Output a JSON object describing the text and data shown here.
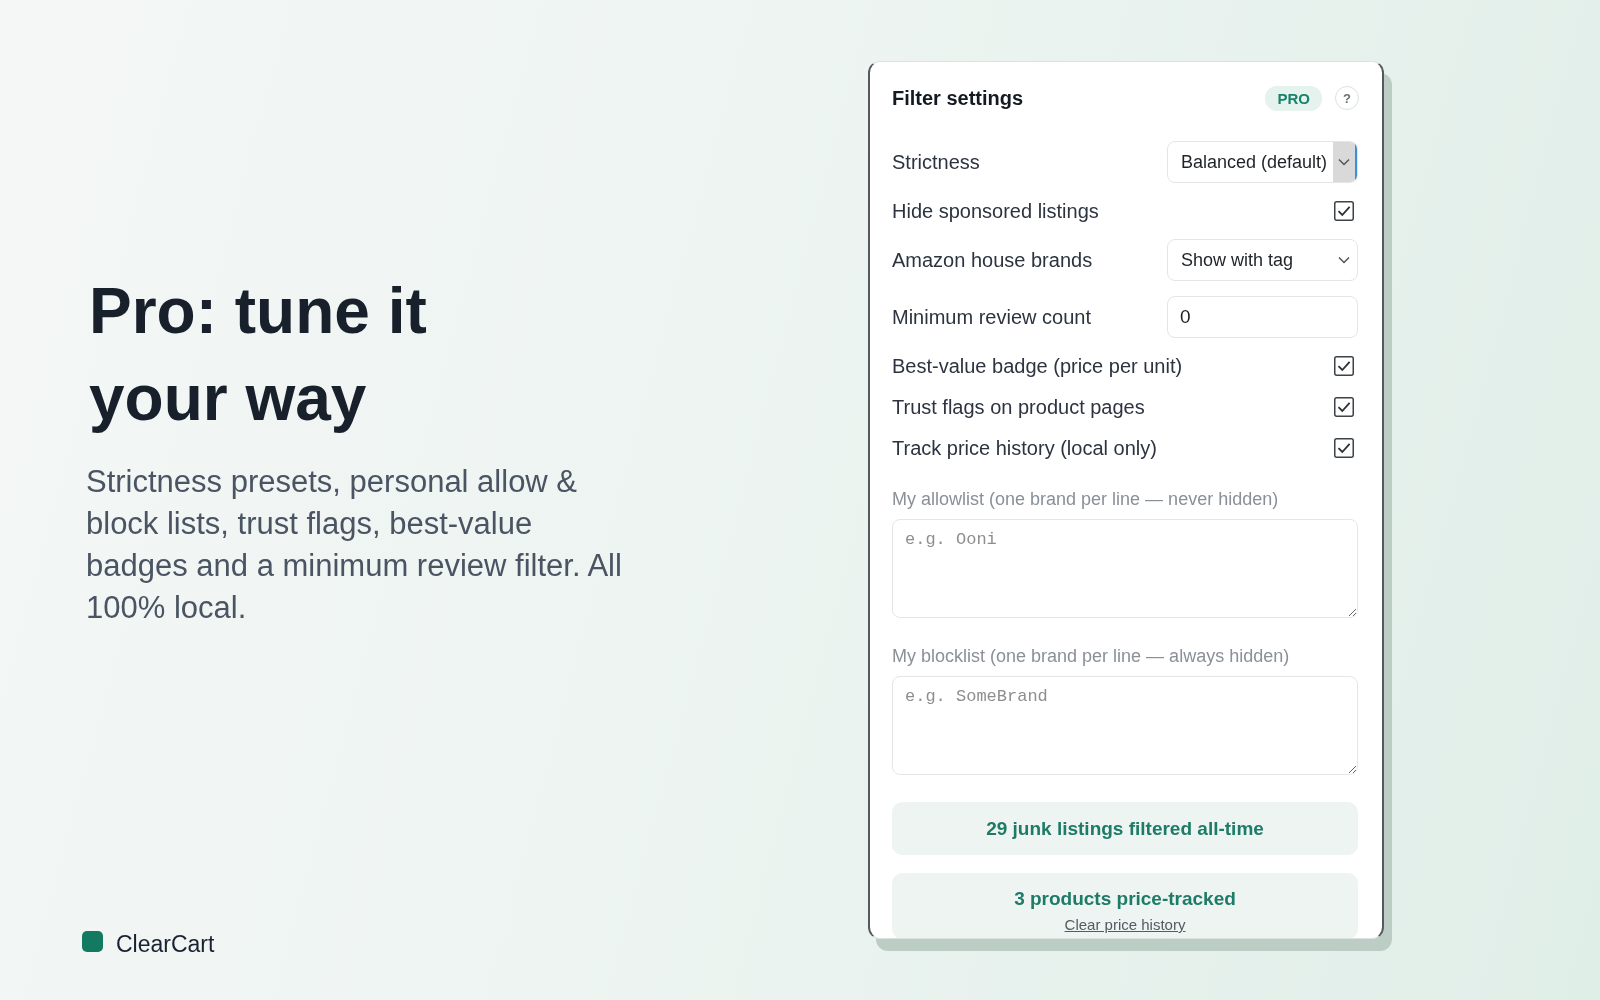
{
  "hero": {
    "title": "Pro: tune it your way",
    "description": "Strictness presets, personal allow & block lists, trust flags, best-value badges and a minimum review filter. All 100% local."
  },
  "brand": {
    "name": "ClearCart"
  },
  "panel": {
    "title": "Filter settings",
    "badge": "PRO",
    "help": "?",
    "settings": [
      {
        "kind": "select",
        "label": "Strictness",
        "value": "Balanced (default)",
        "focused": true
      },
      {
        "kind": "checkbox",
        "label": "Hide sponsored listings",
        "checked": true
      },
      {
        "kind": "select",
        "label": "Amazon house brands",
        "value": "Show with tag",
        "focused": false
      },
      {
        "kind": "number",
        "label": "Minimum review count",
        "value": "0"
      },
      {
        "kind": "checkbox",
        "label": "Best-value badge (price per unit)",
        "checked": true
      },
      {
        "kind": "checkbox",
        "label": "Trust flags on product pages",
        "checked": true
      },
      {
        "kind": "checkbox",
        "label": "Track price history (local only)",
        "checked": true
      },
      {
        "kind": "textarea",
        "label": "My allowlist (one brand per line — never hidden)",
        "placeholder": "e.g. Ooni"
      },
      {
        "kind": "textarea",
        "label": "My blocklist (one brand per line — always hidden)",
        "placeholder": "e.g. SomeBrand"
      }
    ],
    "stats": [
      {
        "text": "29 junk listings filtered all-time"
      },
      {
        "text": "3 products price-tracked",
        "link": "Clear price history"
      }
    ]
  }
}
